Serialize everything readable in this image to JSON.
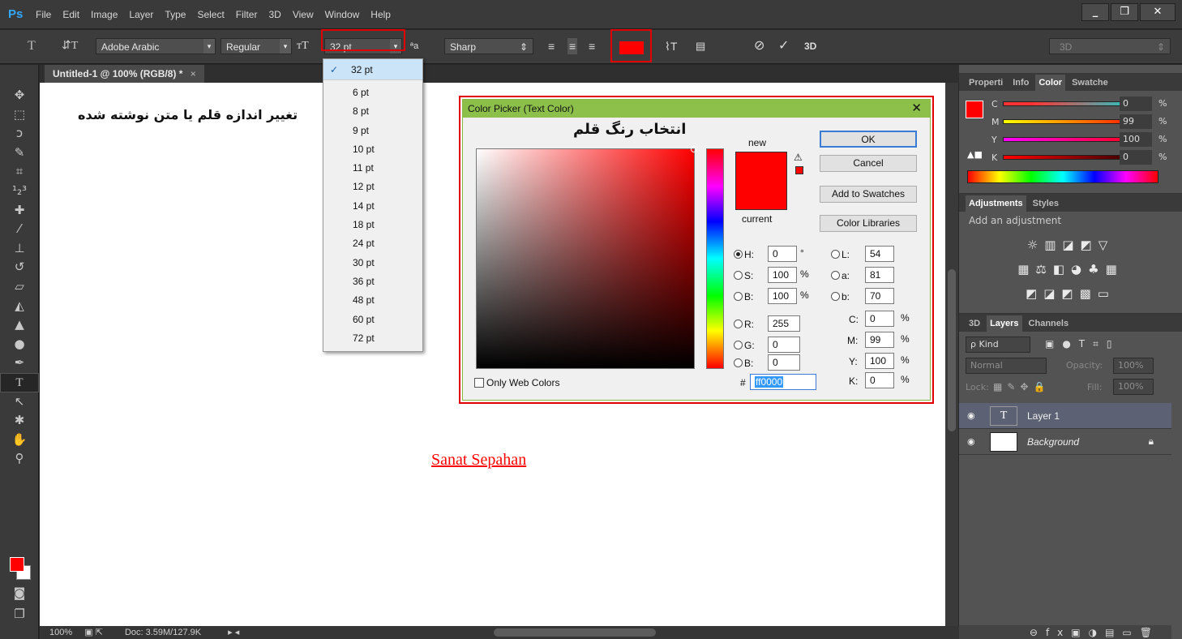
{
  "app": {
    "logo": "Ps"
  },
  "menu": [
    "File",
    "Edit",
    "Image",
    "Layer",
    "Type",
    "Select",
    "Filter",
    "3D",
    "View",
    "Window",
    "Help"
  ],
  "window_controls": {
    "minimize": "_",
    "restore": "❐",
    "close": "✕"
  },
  "options": {
    "font_family": "Adobe Arabic",
    "font_style": "Regular",
    "font_size": "32 pt",
    "aa_label": "ªa",
    "antialias": "Sharp",
    "three_d": "3D",
    "workspace": "3D",
    "text_color": "#ff0000"
  },
  "document": {
    "tab_title": "Untitled-1 @ 100% (RGB/8) *",
    "tab_close": "×",
    "annotation_size": "تغییر اندازه قلم یا متن نوشته شده",
    "sample_text": "Sanat Sepahan"
  },
  "status": {
    "zoom": "100%",
    "doc": "Doc: 3.59M/127.9K"
  },
  "size_dropdown": {
    "selected": "32 pt",
    "items": [
      "6 pt",
      "8 pt",
      "9 pt",
      "10 pt",
      "11 pt",
      "12 pt",
      "14 pt",
      "18 pt",
      "24 pt",
      "30 pt",
      "36 pt",
      "48 pt",
      "60 pt",
      "72 pt"
    ]
  },
  "color_picker": {
    "title": "Color Picker (Text Color)",
    "close": "✕",
    "annotation": "انتخاب رنگ قلم",
    "new_label": "new",
    "current_label": "current",
    "buttons": {
      "ok": "OK",
      "cancel": "Cancel",
      "add_swatches": "Add to Swatches",
      "libraries": "Color Libraries"
    },
    "fields": {
      "H": "0",
      "S": "100",
      "B": "100",
      "R": "255",
      "G": "0",
      "B2": "0",
      "L": "54",
      "a": "81",
      "b": "70",
      "C": "0",
      "M": "99",
      "Y": "100",
      "K": "0"
    },
    "labels": {
      "H": "H:",
      "S": "S:",
      "B": "B:",
      "R": "R:",
      "G": "G:",
      "B2": "B:",
      "L": "L:",
      "a": "a:",
      "b": "b:",
      "C": "C:",
      "M": "M:",
      "Y": "Y:",
      "K": "K:",
      "deg": "°",
      "pct": "%",
      "hash": "#"
    },
    "hex": "ff0000",
    "only_web": "Only Web Colors"
  },
  "color_panel": {
    "tabs": [
      "Properti",
      "Info",
      "Color",
      "Swatche"
    ],
    "sliders": [
      {
        "label": "C",
        "value": "0"
      },
      {
        "label": "M",
        "value": "99"
      },
      {
        "label": "Y",
        "value": "100"
      },
      {
        "label": "K",
        "value": "0"
      }
    ],
    "pct": "%"
  },
  "adjustments_panel": {
    "tabs": [
      "Adjustments",
      "Styles"
    ],
    "hint": "Add an adjustment"
  },
  "layers_panel": {
    "tabs": [
      "3D",
      "Layers",
      "Channels"
    ],
    "filter": "ρ Kind",
    "blend": "Normal",
    "opacity_label": "Opacity:",
    "opacity": "100%",
    "lock_label": "Lock:",
    "fill_label": "Fill:",
    "fill": "100%",
    "layers": [
      {
        "name": "Layer 1",
        "thumb": "T"
      },
      {
        "name": "Background",
        "thumb": ""
      }
    ]
  }
}
